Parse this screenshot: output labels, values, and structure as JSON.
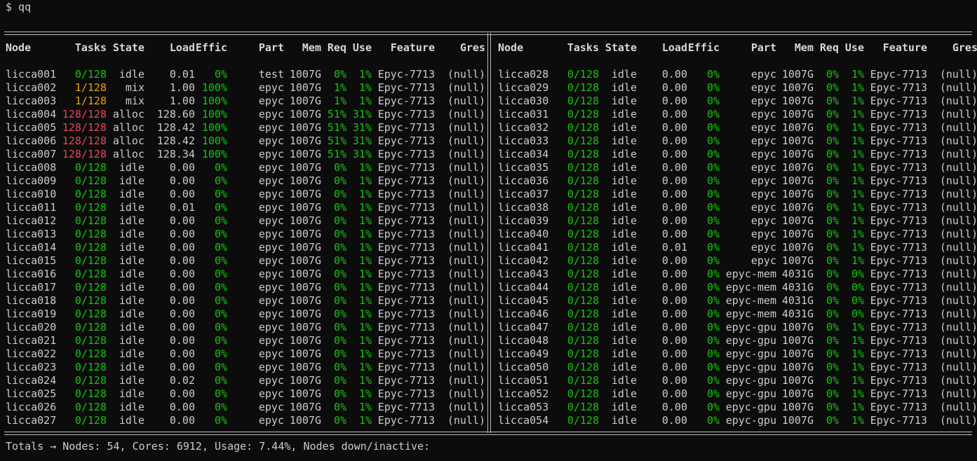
{
  "prompt": "$ qq",
  "headers": {
    "node": "Node",
    "tasks": "Tasks",
    "state": "State",
    "load": "Load",
    "effic": "Effic",
    "part": "Part",
    "mem": "Mem",
    "req": "Req",
    "use": "Use",
    "feature": "Feature",
    "gres": "Gres"
  },
  "colors": {
    "green": "#16c60c",
    "yellow": "#e5a50a",
    "red": "#e74856",
    "text": "#cccccc",
    "background": "#0c0c0c"
  },
  "left_rows": [
    [
      "licca001",
      "0/128",
      "idle",
      "0.01",
      "0%",
      "test",
      "1007G",
      "0%",
      "1%",
      "Epyc-7713",
      "(null)",
      "g"
    ],
    [
      "licca002",
      "1/128",
      "mix",
      "1.00",
      "100%",
      "epyc",
      "1007G",
      "1%",
      "1%",
      "Epyc-7713",
      "(null)",
      "y"
    ],
    [
      "licca003",
      "1/128",
      "mix",
      "1.00",
      "100%",
      "epyc",
      "1007G",
      "1%",
      "1%",
      "Epyc-7713",
      "(null)",
      "y"
    ],
    [
      "licca004",
      "128/128",
      "alloc",
      "128.60",
      "100%",
      "epyc",
      "1007G",
      "51%",
      "31%",
      "Epyc-7713",
      "(null)",
      "r"
    ],
    [
      "licca005",
      "128/128",
      "alloc",
      "128.42",
      "100%",
      "epyc",
      "1007G",
      "51%",
      "31%",
      "Epyc-7713",
      "(null)",
      "r"
    ],
    [
      "licca006",
      "128/128",
      "alloc",
      "128.42",
      "100%",
      "epyc",
      "1007G",
      "51%",
      "31%",
      "Epyc-7713",
      "(null)",
      "r"
    ],
    [
      "licca007",
      "128/128",
      "alloc",
      "128.34",
      "100%",
      "epyc",
      "1007G",
      "51%",
      "31%",
      "Epyc-7713",
      "(null)",
      "r"
    ],
    [
      "licca008",
      "0/128",
      "idle",
      "0.00",
      "0%",
      "epyc",
      "1007G",
      "0%",
      "1%",
      "Epyc-7713",
      "(null)",
      "g"
    ],
    [
      "licca009",
      "0/128",
      "idle",
      "0.00",
      "0%",
      "epyc",
      "1007G",
      "0%",
      "1%",
      "Epyc-7713",
      "(null)",
      "g"
    ],
    [
      "licca010",
      "0/128",
      "idle",
      "0.00",
      "0%",
      "epyc",
      "1007G",
      "0%",
      "1%",
      "Epyc-7713",
      "(null)",
      "g"
    ],
    [
      "licca011",
      "0/128",
      "idle",
      "0.01",
      "0%",
      "epyc",
      "1007G",
      "0%",
      "1%",
      "Epyc-7713",
      "(null)",
      "g"
    ],
    [
      "licca012",
      "0/128",
      "idle",
      "0.00",
      "0%",
      "epyc",
      "1007G",
      "0%",
      "1%",
      "Epyc-7713",
      "(null)",
      "g"
    ],
    [
      "licca013",
      "0/128",
      "idle",
      "0.00",
      "0%",
      "epyc",
      "1007G",
      "0%",
      "1%",
      "Epyc-7713",
      "(null)",
      "g"
    ],
    [
      "licca014",
      "0/128",
      "idle",
      "0.00",
      "0%",
      "epyc",
      "1007G",
      "0%",
      "1%",
      "Epyc-7713",
      "(null)",
      "g"
    ],
    [
      "licca015",
      "0/128",
      "idle",
      "0.00",
      "0%",
      "epyc",
      "1007G",
      "0%",
      "1%",
      "Epyc-7713",
      "(null)",
      "g"
    ],
    [
      "licca016",
      "0/128",
      "idle",
      "0.00",
      "0%",
      "epyc",
      "1007G",
      "0%",
      "1%",
      "Epyc-7713",
      "(null)",
      "g"
    ],
    [
      "licca017",
      "0/128",
      "idle",
      "0.00",
      "0%",
      "epyc",
      "1007G",
      "0%",
      "1%",
      "Epyc-7713",
      "(null)",
      "g"
    ],
    [
      "licca018",
      "0/128",
      "idle",
      "0.00",
      "0%",
      "epyc",
      "1007G",
      "0%",
      "1%",
      "Epyc-7713",
      "(null)",
      "g"
    ],
    [
      "licca019",
      "0/128",
      "idle",
      "0.00",
      "0%",
      "epyc",
      "1007G",
      "0%",
      "1%",
      "Epyc-7713",
      "(null)",
      "g"
    ],
    [
      "licca020",
      "0/128",
      "idle",
      "0.00",
      "0%",
      "epyc",
      "1007G",
      "0%",
      "1%",
      "Epyc-7713",
      "(null)",
      "g"
    ],
    [
      "licca021",
      "0/128",
      "idle",
      "0.00",
      "0%",
      "epyc",
      "1007G",
      "0%",
      "1%",
      "Epyc-7713",
      "(null)",
      "g"
    ],
    [
      "licca022",
      "0/128",
      "idle",
      "0.00",
      "0%",
      "epyc",
      "1007G",
      "0%",
      "1%",
      "Epyc-7713",
      "(null)",
      "g"
    ],
    [
      "licca023",
      "0/128",
      "idle",
      "0.00",
      "0%",
      "epyc",
      "1007G",
      "0%",
      "1%",
      "Epyc-7713",
      "(null)",
      "g"
    ],
    [
      "licca024",
      "0/128",
      "idle",
      "0.02",
      "0%",
      "epyc",
      "1007G",
      "0%",
      "1%",
      "Epyc-7713",
      "(null)",
      "g"
    ],
    [
      "licca025",
      "0/128",
      "idle",
      "0.00",
      "0%",
      "epyc",
      "1007G",
      "0%",
      "1%",
      "Epyc-7713",
      "(null)",
      "g"
    ],
    [
      "licca026",
      "0/128",
      "idle",
      "0.00",
      "0%",
      "epyc",
      "1007G",
      "0%",
      "1%",
      "Epyc-7713",
      "(null)",
      "g"
    ],
    [
      "licca027",
      "0/128",
      "idle",
      "0.00",
      "0%",
      "epyc",
      "1007G",
      "0%",
      "1%",
      "Epyc-7713",
      "(null)",
      "g"
    ]
  ],
  "right_rows": [
    [
      "licca028",
      "0/128",
      "idle",
      "0.00",
      "0%",
      "epyc",
      "1007G",
      "0%",
      "1%",
      "Epyc-7713",
      "(null)",
      "g"
    ],
    [
      "licca029",
      "0/128",
      "idle",
      "0.00",
      "0%",
      "epyc",
      "1007G",
      "0%",
      "1%",
      "Epyc-7713",
      "(null)",
      "g"
    ],
    [
      "licca030",
      "0/128",
      "idle",
      "0.00",
      "0%",
      "epyc",
      "1007G",
      "0%",
      "1%",
      "Epyc-7713",
      "(null)",
      "g"
    ],
    [
      "licca031",
      "0/128",
      "idle",
      "0.00",
      "0%",
      "epyc",
      "1007G",
      "0%",
      "1%",
      "Epyc-7713",
      "(null)",
      "g"
    ],
    [
      "licca032",
      "0/128",
      "idle",
      "0.00",
      "0%",
      "epyc",
      "1007G",
      "0%",
      "1%",
      "Epyc-7713",
      "(null)",
      "g"
    ],
    [
      "licca033",
      "0/128",
      "idle",
      "0.00",
      "0%",
      "epyc",
      "1007G",
      "0%",
      "1%",
      "Epyc-7713",
      "(null)",
      "g"
    ],
    [
      "licca034",
      "0/128",
      "idle",
      "0.00",
      "0%",
      "epyc",
      "1007G",
      "0%",
      "1%",
      "Epyc-7713",
      "(null)",
      "g"
    ],
    [
      "licca035",
      "0/128",
      "idle",
      "0.00",
      "0%",
      "epyc",
      "1007G",
      "0%",
      "1%",
      "Epyc-7713",
      "(null)",
      "g"
    ],
    [
      "licca036",
      "0/128",
      "idle",
      "0.00",
      "0%",
      "epyc",
      "1007G",
      "0%",
      "1%",
      "Epyc-7713",
      "(null)",
      "g"
    ],
    [
      "licca037",
      "0/128",
      "idle",
      "0.00",
      "0%",
      "epyc",
      "1007G",
      "0%",
      "1%",
      "Epyc-7713",
      "(null)",
      "g"
    ],
    [
      "licca038",
      "0/128",
      "idle",
      "0.00",
      "0%",
      "epyc",
      "1007G",
      "0%",
      "1%",
      "Epyc-7713",
      "(null)",
      "g"
    ],
    [
      "licca039",
      "0/128",
      "idle",
      "0.00",
      "0%",
      "epyc",
      "1007G",
      "0%",
      "1%",
      "Epyc-7713",
      "(null)",
      "g"
    ],
    [
      "licca040",
      "0/128",
      "idle",
      "0.00",
      "0%",
      "epyc",
      "1007G",
      "0%",
      "1%",
      "Epyc-7713",
      "(null)",
      "g"
    ],
    [
      "licca041",
      "0/128",
      "idle",
      "0.01",
      "0%",
      "epyc",
      "1007G",
      "0%",
      "1%",
      "Epyc-7713",
      "(null)",
      "g"
    ],
    [
      "licca042",
      "0/128",
      "idle",
      "0.00",
      "0%",
      "epyc",
      "1007G",
      "0%",
      "1%",
      "Epyc-7713",
      "(null)",
      "g"
    ],
    [
      "licca043",
      "0/128",
      "idle",
      "0.00",
      "0%",
      "epyc-mem",
      "4031G",
      "0%",
      "0%",
      "Epyc-7713",
      "(null)",
      "g"
    ],
    [
      "licca044",
      "0/128",
      "idle",
      "0.00",
      "0%",
      "epyc-mem",
      "4031G",
      "0%",
      "0%",
      "Epyc-7713",
      "(null)",
      "g"
    ],
    [
      "licca045",
      "0/128",
      "idle",
      "0.00",
      "0%",
      "epyc-mem",
      "4031G",
      "0%",
      "0%",
      "Epyc-7713",
      "(null)",
      "g"
    ],
    [
      "licca046",
      "0/128",
      "idle",
      "0.00",
      "0%",
      "epyc-mem",
      "4031G",
      "0%",
      "0%",
      "Epyc-7713",
      "(null)",
      "g"
    ],
    [
      "licca047",
      "0/128",
      "idle",
      "0.00",
      "0%",
      "epyc-gpu",
      "1007G",
      "0%",
      "1%",
      "Epyc-7713",
      "(null)",
      "g"
    ],
    [
      "licca048",
      "0/128",
      "idle",
      "0.00",
      "0%",
      "epyc-gpu",
      "1007G",
      "0%",
      "1%",
      "Epyc-7713",
      "(null)",
      "g"
    ],
    [
      "licca049",
      "0/128",
      "idle",
      "0.00",
      "0%",
      "epyc-gpu",
      "1007G",
      "0%",
      "1%",
      "Epyc-7713",
      "(null)",
      "g"
    ],
    [
      "licca050",
      "0/128",
      "idle",
      "0.00",
      "0%",
      "epyc-gpu",
      "1007G",
      "0%",
      "1%",
      "Epyc-7713",
      "(null)",
      "g"
    ],
    [
      "licca051",
      "0/128",
      "idle",
      "0.00",
      "0%",
      "epyc-gpu",
      "1007G",
      "0%",
      "1%",
      "Epyc-7713",
      "(null)",
      "g"
    ],
    [
      "licca052",
      "0/128",
      "idle",
      "0.00",
      "0%",
      "epyc-gpu",
      "1007G",
      "0%",
      "1%",
      "Epyc-7713",
      "(null)",
      "g"
    ],
    [
      "licca053",
      "0/128",
      "idle",
      "0.00",
      "0%",
      "epyc-gpu",
      "1007G",
      "0%",
      "1%",
      "Epyc-7713",
      "(null)",
      "g"
    ],
    [
      "licca054",
      "0/128",
      "idle",
      "0.00",
      "0%",
      "epyc-gpu",
      "1007G",
      "0%",
      "1%",
      "Epyc-7713",
      "(null)",
      "g"
    ]
  ],
  "totals": "Totals → Nodes: 54, Cores: 6912, Usage: 7.44%, Nodes down/inactive:"
}
